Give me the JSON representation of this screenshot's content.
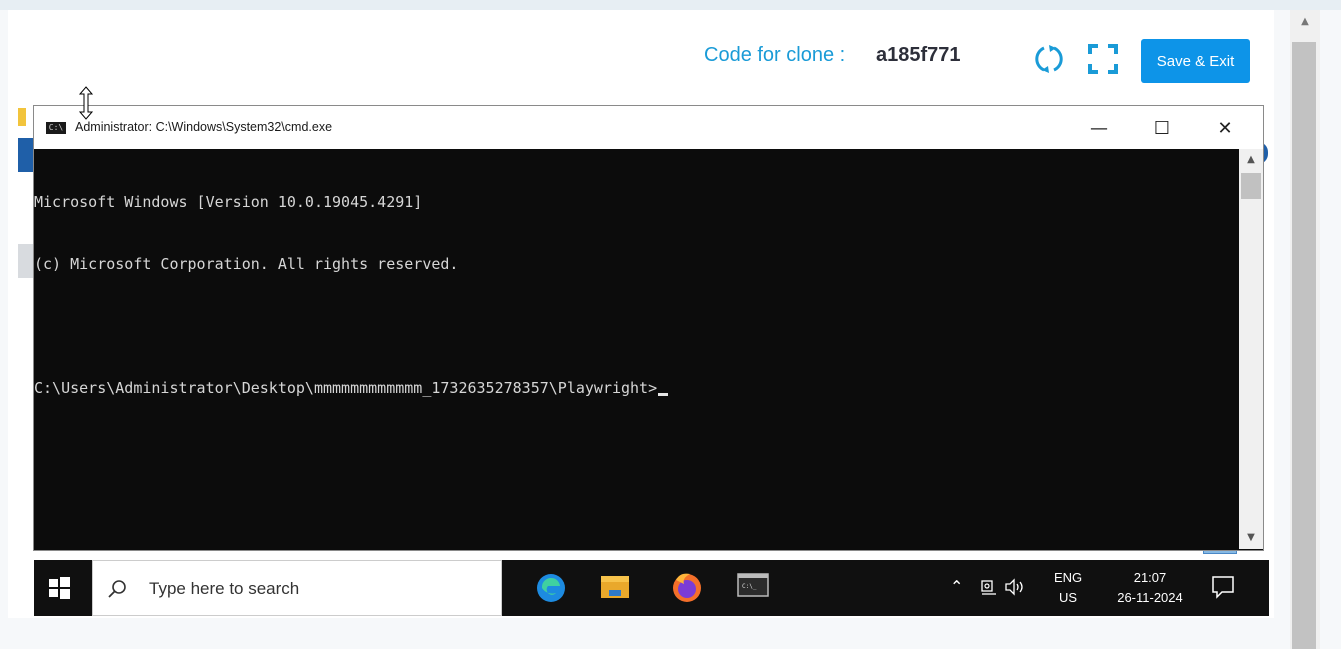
{
  "header": {
    "clone_label": "Code for clone :",
    "clone_code": "a185f771",
    "save_label": "Save & Exit"
  },
  "cmd": {
    "title": "Administrator: C:\\Windows\\System32\\cmd.exe",
    "icon_text": "C:\\",
    "minimize": "—",
    "maximize": "☐",
    "close": "✕",
    "lines": [
      "Microsoft Windows [Version 10.0.19045.4291]",
      "(c) Microsoft Corporation. All rights reserved.",
      "",
      "C:\\Users\\Administrator\\Desktop\\mmmmmmmmmmmm_1732635278357\\Playwright>"
    ]
  },
  "taskbar": {
    "search_placeholder": "Type here to search",
    "lang_top": "ENG",
    "lang_bottom": "US",
    "time": "21:07",
    "date": "26-11-2024"
  },
  "colors": {
    "accent": "#0d94e8",
    "clone_label": "#1a9bd7",
    "terminal_bg": "#0c0c0c",
    "taskbar_bg": "#101010"
  },
  "icons": [
    "sync-icon",
    "fullscreen-icon",
    "windows-start-icon",
    "search-icon",
    "edge-icon",
    "file-explorer-icon",
    "firefox-icon",
    "cmd-icon",
    "chevron-up-icon",
    "meet-now-icon",
    "speaker-icon",
    "notification-icon"
  ]
}
